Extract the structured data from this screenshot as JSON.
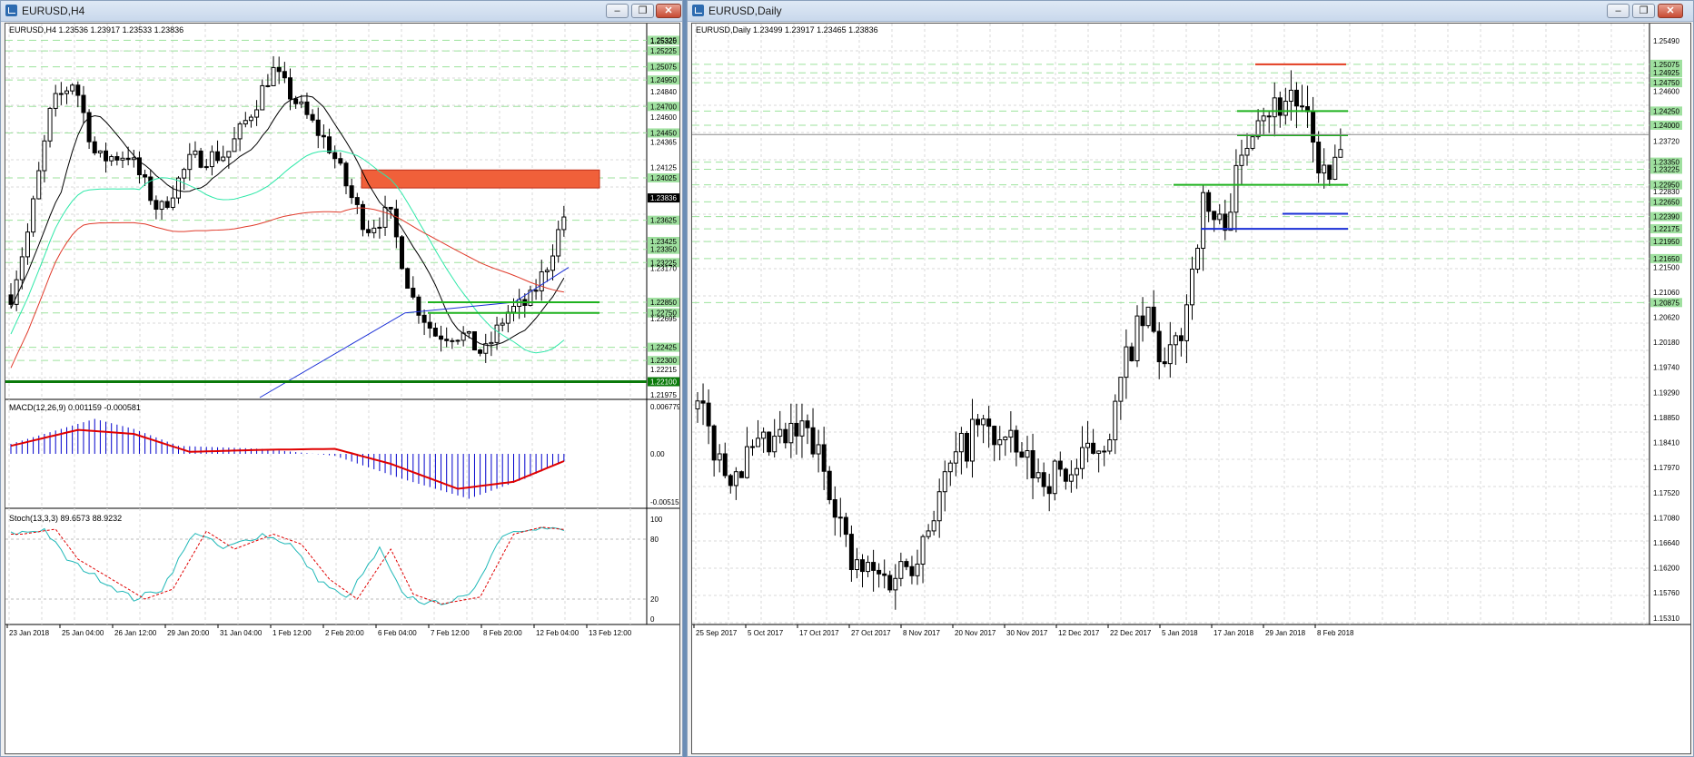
{
  "left": {
    "title": "EURUSD,H4",
    "buttons": {
      "minimize": "–",
      "restore": "❐",
      "close": "✕"
    },
    "header": "EURUSD,H4  1.23536 1.23917 1.23533 1.23836",
    "price_labels": [
      "1.25325",
      "1.25320",
      "1.25225",
      "1.25075",
      "1.24950",
      "1.24840",
      "1.24700",
      "1.24600",
      "1.24450",
      "1.24365",
      "1.24125",
      "1.24025",
      "1.23836",
      "1.23625",
      "1.23425",
      "1.23350",
      "1.23225",
      "1.23170",
      "1.22850",
      "1.22750",
      "1.22695",
      "1.22425",
      "1.22300",
      "1.22215",
      "1.22100",
      "1.21975"
    ],
    "current_price": "1.23836",
    "macd_label": "MACD(12,26,9) 0.001159 -0.000581",
    "macd_scale": [
      "0.006779",
      "0.00",
      "-0.005159"
    ],
    "stoch_label": "Stoch(13,3,3) 89.6573 88.9232",
    "stoch_scale": [
      "100",
      "80",
      "20",
      "0"
    ],
    "time_labels": [
      "23 Jan 2018",
      "25 Jan 04:00",
      "26 Jan 12:00",
      "29 Jan 20:00",
      "31 Jan 04:00",
      "1 Feb 12:00",
      "2 Feb 20:00",
      "6 Feb 04:00",
      "7 Feb 12:00",
      "8 Feb 20:00",
      "12 Feb 04:00",
      "13 Feb 12:00"
    ]
  },
  "right": {
    "title": "EURUSD,Daily",
    "buttons": {
      "minimize": "–",
      "restore": "❐",
      "close": "✕"
    },
    "header": "EURUSD,Daily  1.23499 1.23917 1.23465 1.23836",
    "price_labels": [
      "1.25490",
      "1.25075",
      "1.24925",
      "1.24750",
      "1.24600",
      "1.24250",
      "1.24000",
      "1.23720",
      "1.23350",
      "1.23225",
      "1.22950",
      "1.22830",
      "1.22650",
      "1.22390",
      "1.22175",
      "1.21950",
      "1.21650",
      "1.21500",
      "1.21060",
      "1.20875",
      "1.20620",
      "1.20180",
      "1.19740",
      "1.19290",
      "1.18850",
      "1.18410",
      "1.17970",
      "1.17520",
      "1.17080",
      "1.16640",
      "1.16200",
      "1.15760",
      "1.15310"
    ],
    "time_labels": [
      "25 Sep 2017",
      "5 Oct 2017",
      "17 Oct 2017",
      "27 Oct 2017",
      "8 Nov 2017",
      "20 Nov 2017",
      "30 Nov 2017",
      "12 Dec 2017",
      "22 Dec 2017",
      "5 Jan 2018",
      "17 Jan 2018",
      "29 Jan 2018",
      "8 Feb 2018"
    ]
  },
  "colors": {
    "bull_fill": "#ffffff",
    "bear_fill": "#000000",
    "support": "#1fb21f",
    "resistance": "#e23b1f",
    "zone": "#f0603a",
    "macd_signal": "#e00000",
    "macd_hist": "#0000cc",
    "ma_fast": "#000000",
    "ma_mid": "#2ee8a8",
    "ma_slow": "#e03a2a",
    "ma_long": "#1a2fd6",
    "stoch_main": "#1fb8b8",
    "stoch_signal": "#e00000",
    "dashed_level": "#9de29d"
  }
}
